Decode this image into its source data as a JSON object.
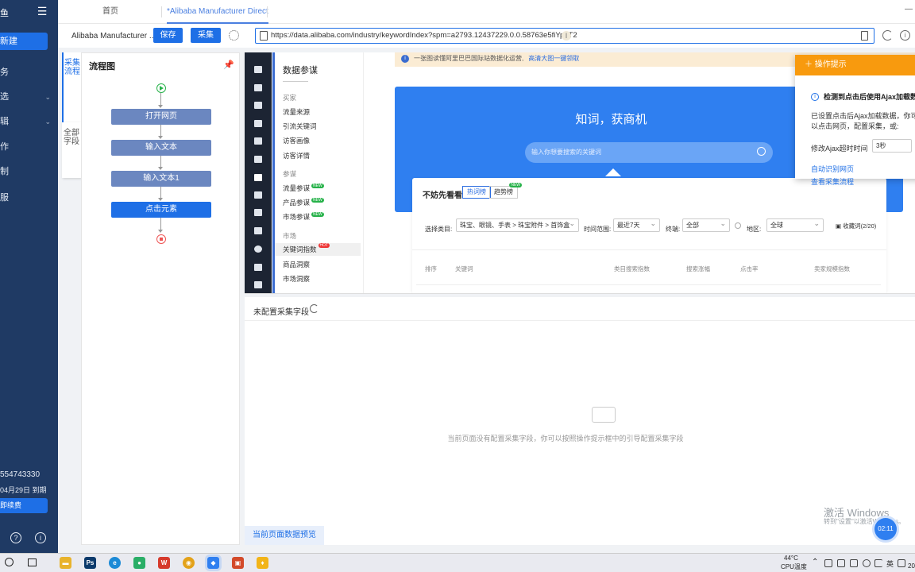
{
  "sidebar": {
    "logo_fragment": "鱼",
    "new_label": "新建",
    "items": [
      {
        "label": "务",
        "chevron": false
      },
      {
        "label": "选",
        "chevron": true
      },
      {
        "label": "辑",
        "chevron": true
      },
      {
        "label": "作",
        "chevron": false
      },
      {
        "label": "制",
        "chevron": false
      },
      {
        "label": "服",
        "chevron": false
      }
    ],
    "account_id": "554743330",
    "expiry": "04月29日 到期",
    "renew_label": "即续费"
  },
  "tabs": [
    {
      "label": "首页",
      "active": false
    },
    {
      "label": "*Alibaba Manufacturer Direct",
      "active": true
    }
  ],
  "toolbar": {
    "task_name": "Alibaba Manufacturer ...",
    "save_label": "保存",
    "collect_label": "采集",
    "url": "https://data.alibaba.com/industry/keywordIndex?spm=a2793.12437229.0.0.58763e5fiYpuT2",
    "cursor_glyph": "I"
  },
  "left_tabs": {
    "flow_label": "采集流程",
    "fields_label": "全部字段"
  },
  "flow": {
    "title": "流程图",
    "nodes": [
      {
        "label": "打开网页",
        "selected": false
      },
      {
        "label": "输入文本",
        "selected": false
      },
      {
        "label": "输入文本1",
        "selected": false
      },
      {
        "label": "点击元素",
        "selected": true
      }
    ]
  },
  "web": {
    "menu_title": "数据参谋",
    "sections": [
      {
        "title": "买家",
        "items": [
          {
            "label": "流量来源",
            "badge": ""
          },
          {
            "label": "引流关键词",
            "badge": ""
          },
          {
            "label": "访客画像",
            "badge": ""
          },
          {
            "label": "访客详情",
            "badge": ""
          }
        ]
      },
      {
        "title": "参谋",
        "items": [
          {
            "label": "流量参谋",
            "badge": "NEW"
          },
          {
            "label": "产品参谋",
            "badge": "NEW"
          },
          {
            "label": "市场参谋",
            "badge": "NEW"
          }
        ]
      },
      {
        "title": "市场",
        "items": [
          {
            "label": "关键词指数",
            "badge": "HOT"
          },
          {
            "label": "商品洞察",
            "badge": ""
          },
          {
            "label": "市场洞察",
            "badge": ""
          }
        ]
      }
    ],
    "notice_text": "一张图读懂阿里巴巴国际站数据化运营,",
    "notice_link": "高清大图一键领取",
    "hero_slogan": "知词，获商机",
    "search_placeholder": "输入你想要搜索的关键词",
    "card_title": "不妨先看看",
    "pills": [
      {
        "label": "热词榜",
        "active": true
      },
      {
        "label": "趋势榜",
        "active": false
      }
    ],
    "filters": {
      "category_label": "选择类目:",
      "category_value": "珠宝、眼镜、手表 > 珠宝附件 > 首饰盒",
      "time_label": "时间范围:",
      "time_value": "最近7天",
      "device_label": "终端:",
      "device_value": "全部",
      "region_label": "地区:",
      "region_value": "全球",
      "fav_label": "收藏词(2/20)"
    },
    "columns": [
      "排序",
      "关键词",
      "类目搜索指数",
      "搜索涨幅",
      "点击率",
      "卖家规模指数"
    ]
  },
  "tips": {
    "header": "操作提示",
    "title": "检测到点击后使用Ajax加载数",
    "body": "已设置点击后Ajax加载数据，你可以点击网页，配置采集，或:",
    "timeout_label": "修改Ajax超时时间",
    "timeout_value": "3秒",
    "link1": "自动识别网页",
    "link2": "查看采集流程"
  },
  "config": {
    "header": "未配置采集字段",
    "empty_text": "当前页面没有配置采集字段，你可以按照操作提示框中的引导配置采集字段",
    "preview_label": "当前页面数据预览",
    "watermark1": "激活 Windows",
    "watermark2": "转到\"设置\"以激活Windows。",
    "timer": "02:11"
  },
  "taskbar": {
    "apps": [
      {
        "name": "explorer",
        "glyph": "▬",
        "color": "#e8b32c"
      },
      {
        "name": "photoshop",
        "glyph": "Ps",
        "color": "#0c3a6b"
      },
      {
        "name": "edge",
        "glyph": "e",
        "color": "#1c8ad6"
      },
      {
        "name": "wechat",
        "glyph": "●",
        "color": "#2aae67"
      },
      {
        "name": "wps",
        "glyph": "W",
        "color": "#d63a2c"
      },
      {
        "name": "chrome",
        "glyph": "◉",
        "color": "#e3a21a"
      },
      {
        "name": "collector",
        "glyph": "◆",
        "color": "#2f7ff0"
      },
      {
        "name": "app8",
        "glyph": "▣",
        "color": "#d34a2a"
      },
      {
        "name": "app9",
        "glyph": "♦",
        "color": "#f2b418"
      }
    ],
    "temperature": "44°C",
    "cpu_label": "CPU温度",
    "ime": "英",
    "year_fragment": "20"
  },
  "colors": {
    "sidebar_bg": "#1f3a64",
    "accent": "#1e6fe6",
    "tips_header": "#f89a0e",
    "hero": "#2f7ff0"
  }
}
